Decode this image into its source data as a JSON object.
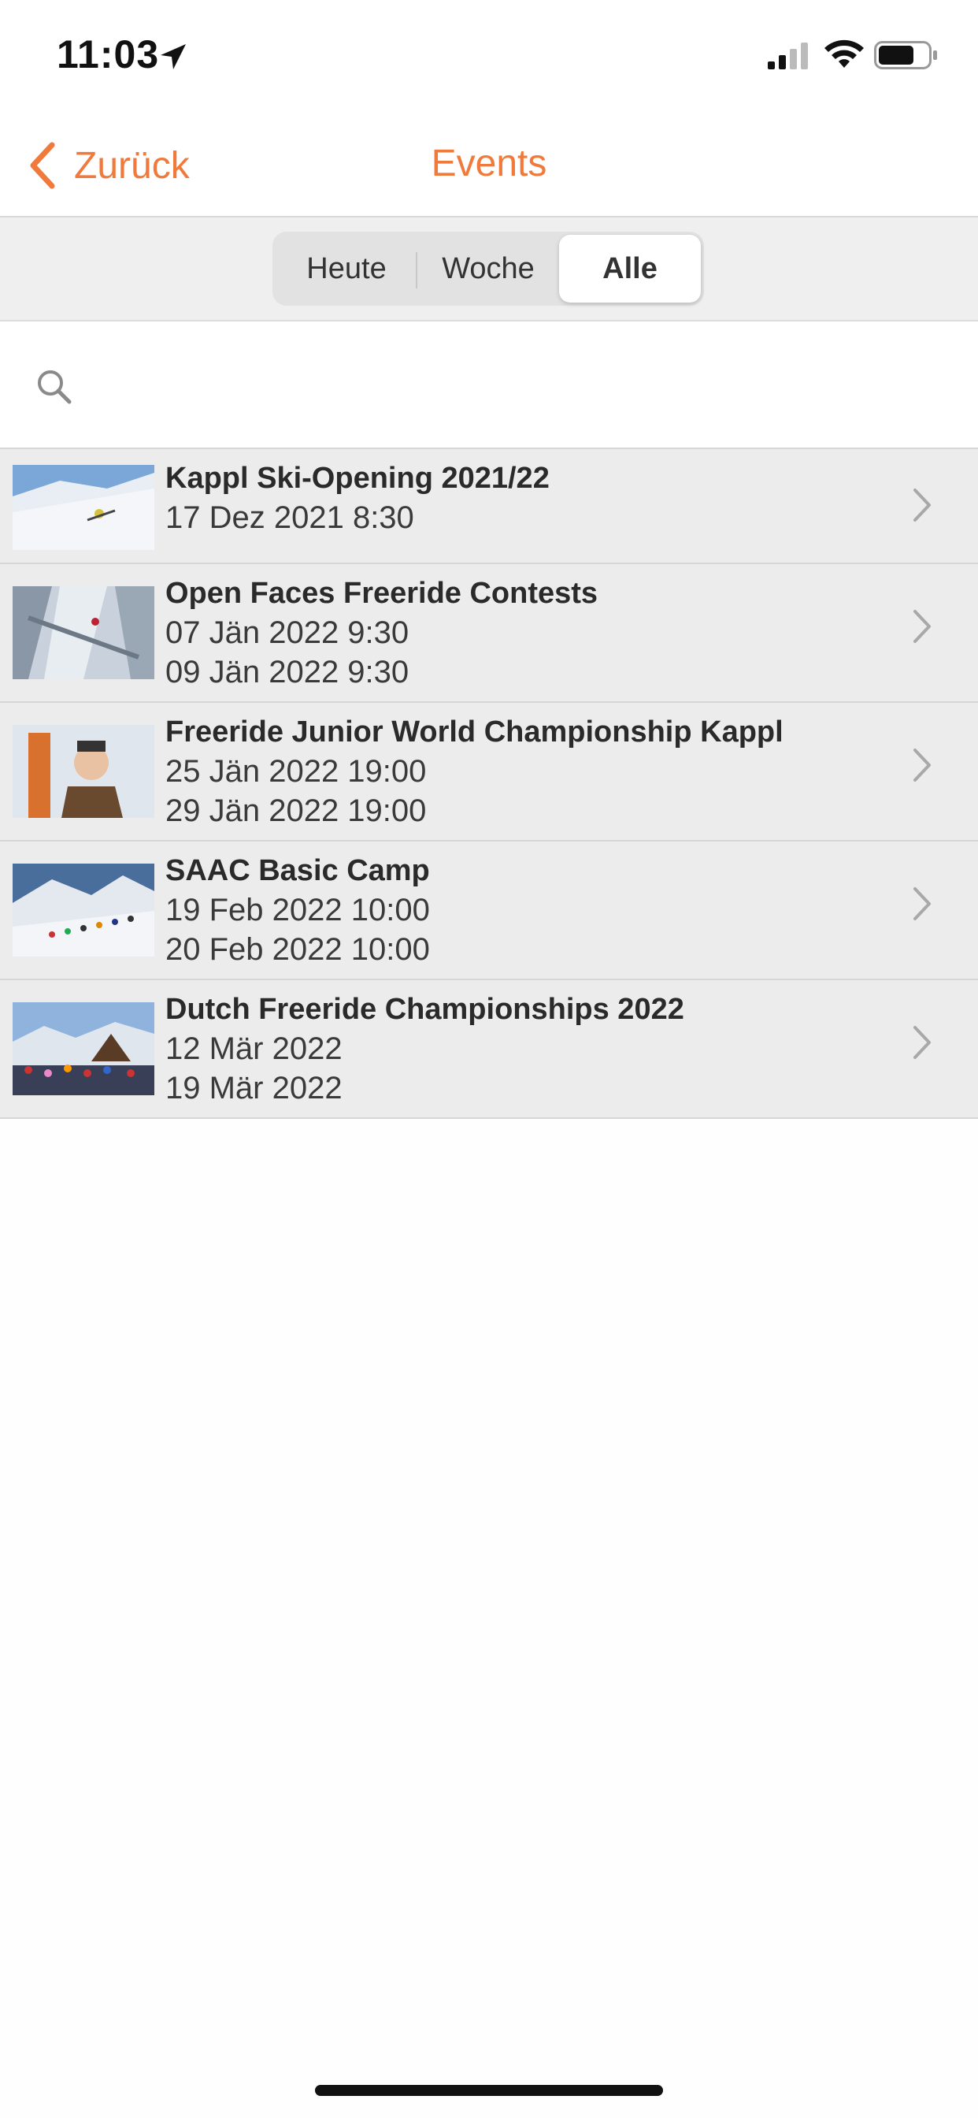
{
  "status_bar": {
    "time": "11:03",
    "icons": [
      "location-arrow-icon",
      "signal-icon",
      "wifi-icon",
      "battery-icon"
    ]
  },
  "nav": {
    "back_label": "Zurück",
    "title": "Events",
    "accent_color": "#f07a3c"
  },
  "segments": {
    "items": [
      {
        "label": "Heute"
      },
      {
        "label": "Woche"
      },
      {
        "label": "Alle"
      }
    ],
    "selected": "Alle"
  },
  "search": {
    "placeholder": "",
    "value": ""
  },
  "events": [
    {
      "title": "Kappl Ski-Opening 2021/22",
      "dates": [
        "17 Dez 2021 8:30"
      ],
      "thumbnail": "skier-on-slope"
    },
    {
      "title": "Open Faces Freeride Contests",
      "dates": [
        "07 Jän 2022 9:30",
        "09 Jän 2022 9:30"
      ],
      "thumbnail": "freerider-on-cliff"
    },
    {
      "title": "Freeride Junior World Championship Kappl",
      "dates": [
        "25 Jän 2022 19:00",
        "29 Jän 2022 19:00"
      ],
      "thumbnail": "junior-skier-portrait"
    },
    {
      "title": "SAAC Basic Camp",
      "dates": [
        "19 Feb 2022 10:00",
        "20 Feb 2022 10:00"
      ],
      "thumbnail": "group-on-ridge"
    },
    {
      "title": "Dutch Freeride Championships 2022",
      "dates": [
        "12 Mär 2022",
        "19 Mär 2022"
      ],
      "thumbnail": "crowd-at-hut"
    }
  ]
}
